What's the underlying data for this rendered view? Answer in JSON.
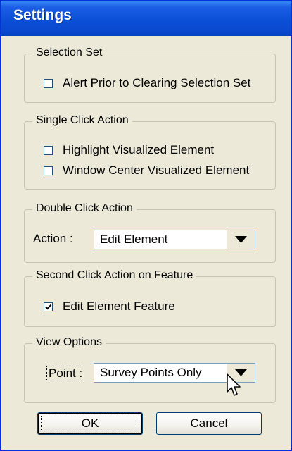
{
  "window": {
    "title": "Settings"
  },
  "selection_set": {
    "legend": "Selection Set",
    "alert_label": "Alert Prior to Clearing Selection Set",
    "alert_checked": false
  },
  "single_click": {
    "legend": "Single Click Action",
    "highlight_label": "Highlight Visualized Element",
    "highlight_checked": false,
    "window_center_label": "Window Center Visualized Element",
    "window_center_checked": false
  },
  "double_click": {
    "legend": "Double Click Action",
    "action_label": "Action :",
    "action_value": "Edit Element"
  },
  "second_click": {
    "legend": "Second Click Action on Feature",
    "edit_feature_label": "Edit Element Feature",
    "edit_feature_checked": true
  },
  "view_options": {
    "legend": "View Options",
    "point_label": "Point :",
    "point_value": "Survey Points Only"
  },
  "buttons": {
    "ok": "OK",
    "ok_mnemonic": "O",
    "cancel": "Cancel"
  },
  "icons": {
    "dropdown": "chevron-down-icon",
    "cursor": "mouse-pointer-icon"
  },
  "colors": {
    "title_bar": "#0a4fd6",
    "dialog_background": "#ece9d8"
  }
}
